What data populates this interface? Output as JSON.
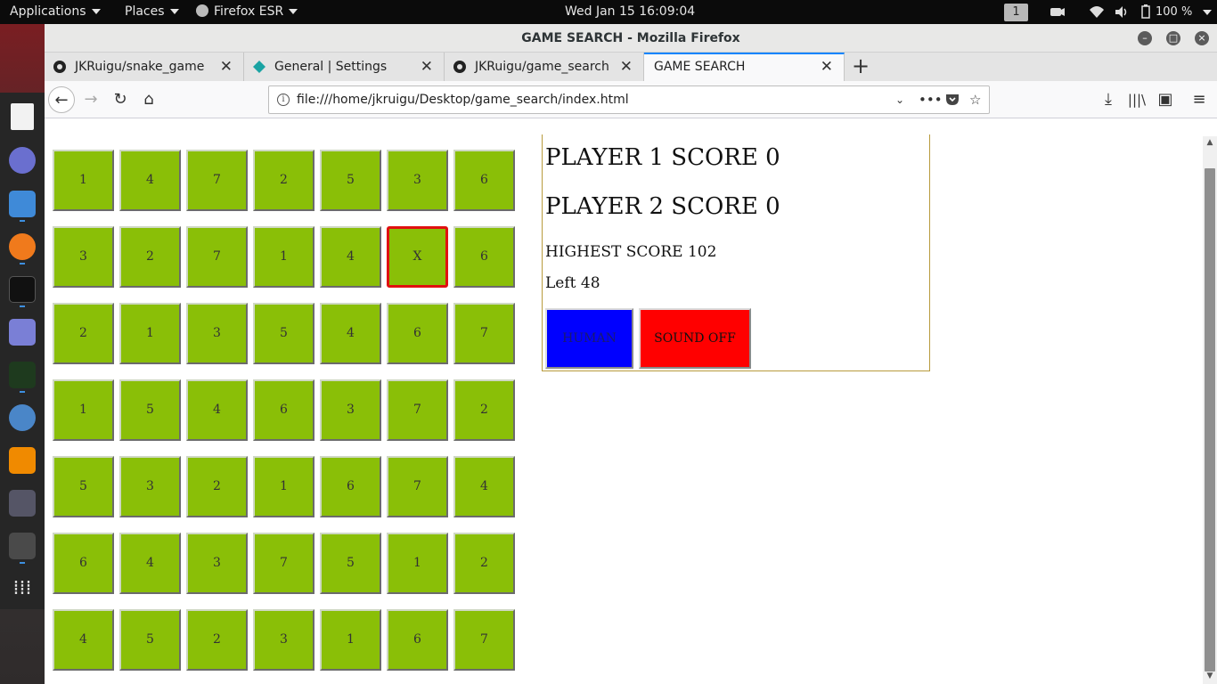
{
  "topbar": {
    "applications": "Applications",
    "places": "Places",
    "firefox": "Firefox ESR",
    "clock": "Wed Jan 15  16:09:04",
    "workspace": "1",
    "battery": "100 %"
  },
  "window": {
    "title": "GAME SEARCH - Mozilla Firefox"
  },
  "tabs": [
    {
      "label": "JKRuigu/snake_game",
      "icon": "github-icon"
    },
    {
      "label": "General | Settings",
      "icon": "settings-diamond-icon"
    },
    {
      "label": "JKRuigu/game_search",
      "icon": "github-icon"
    },
    {
      "label": "GAME SEARCH",
      "icon": ""
    }
  ],
  "url": {
    "value": "file:///home/jkruigu/Desktop/game_search/index.html"
  },
  "board": {
    "rows": [
      [
        "1",
        "4",
        "7",
        "2",
        "5",
        "3",
        "6"
      ],
      [
        "3",
        "2",
        "7",
        "1",
        "4",
        "X",
        "6"
      ],
      [
        "2",
        "1",
        "3",
        "5",
        "4",
        "6",
        "7"
      ],
      [
        "1",
        "5",
        "4",
        "6",
        "3",
        "7",
        "2"
      ],
      [
        "5",
        "3",
        "2",
        "1",
        "6",
        "7",
        "4"
      ],
      [
        "6",
        "4",
        "3",
        "7",
        "5",
        "1",
        "2"
      ],
      [
        "4",
        "5",
        "2",
        "3",
        "1",
        "6",
        "7"
      ]
    ],
    "selected": {
      "row": 1,
      "col": 5
    },
    "cell_color": "#8abf07",
    "selected_border_color": "#e01010"
  },
  "panel": {
    "player1": "PLAYER 1 SCORE 0",
    "player2": "PLAYER 2 SCORE 0",
    "highest": "HIGHEST SCORE 102",
    "left": "Left 48",
    "human_button": "HUMAN",
    "sound_button": "SOUND OFF",
    "human_color": "#0000ff",
    "sound_color": "#ff0000"
  }
}
